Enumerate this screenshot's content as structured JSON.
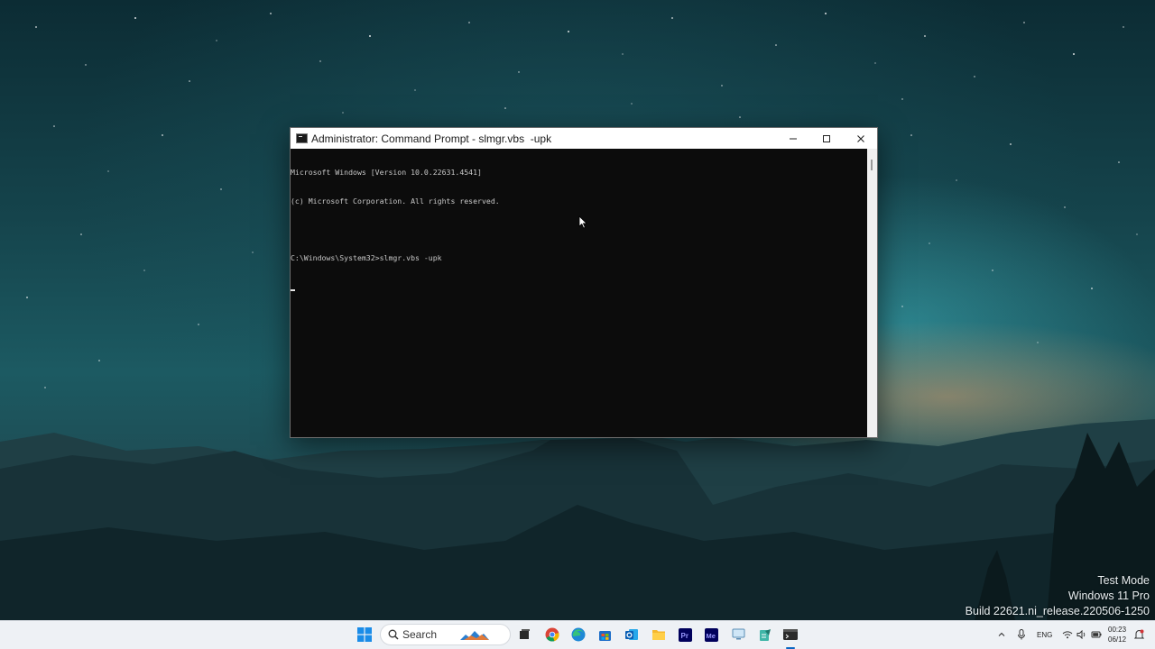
{
  "desktop": {
    "watermark": {
      "line1": "Test Mode",
      "line2": "Windows 11 Pro",
      "line3": "Build 22621.ni_release.220506-1250"
    }
  },
  "console_window": {
    "title": "Administrator: Command Prompt - slmgr.vbs  -upk",
    "lines": [
      "Microsoft Windows [Version 10.0.22631.4541]",
      "(c) Microsoft Corporation. All rights reserved.",
      "",
      "C:\\Windows\\System32>slmgr.vbs -upk"
    ],
    "controls": {
      "minimize": "–",
      "maximize": "☐",
      "close": "✕"
    }
  },
  "taskbar": {
    "search_label": "Search",
    "icons": [
      "windows-start-icon",
      "search-icon",
      "file-explorer-icon",
      "chrome-icon",
      "edge-icon",
      "store-icon",
      "outlook-icon",
      "folder-icon",
      "premiere-pro-icon",
      "media-encoder-icon",
      "remote-desktop-icon",
      "notepad-icon",
      "terminal-icon"
    ],
    "tray": {
      "language": "ENG",
      "time": "00:23",
      "date": "06/12"
    }
  },
  "colors": {
    "console_bg": "#0c0c0c",
    "console_text": "#c8c8c8",
    "taskbar_bg": "#eef1f5",
    "accent": "#0a66c2"
  }
}
